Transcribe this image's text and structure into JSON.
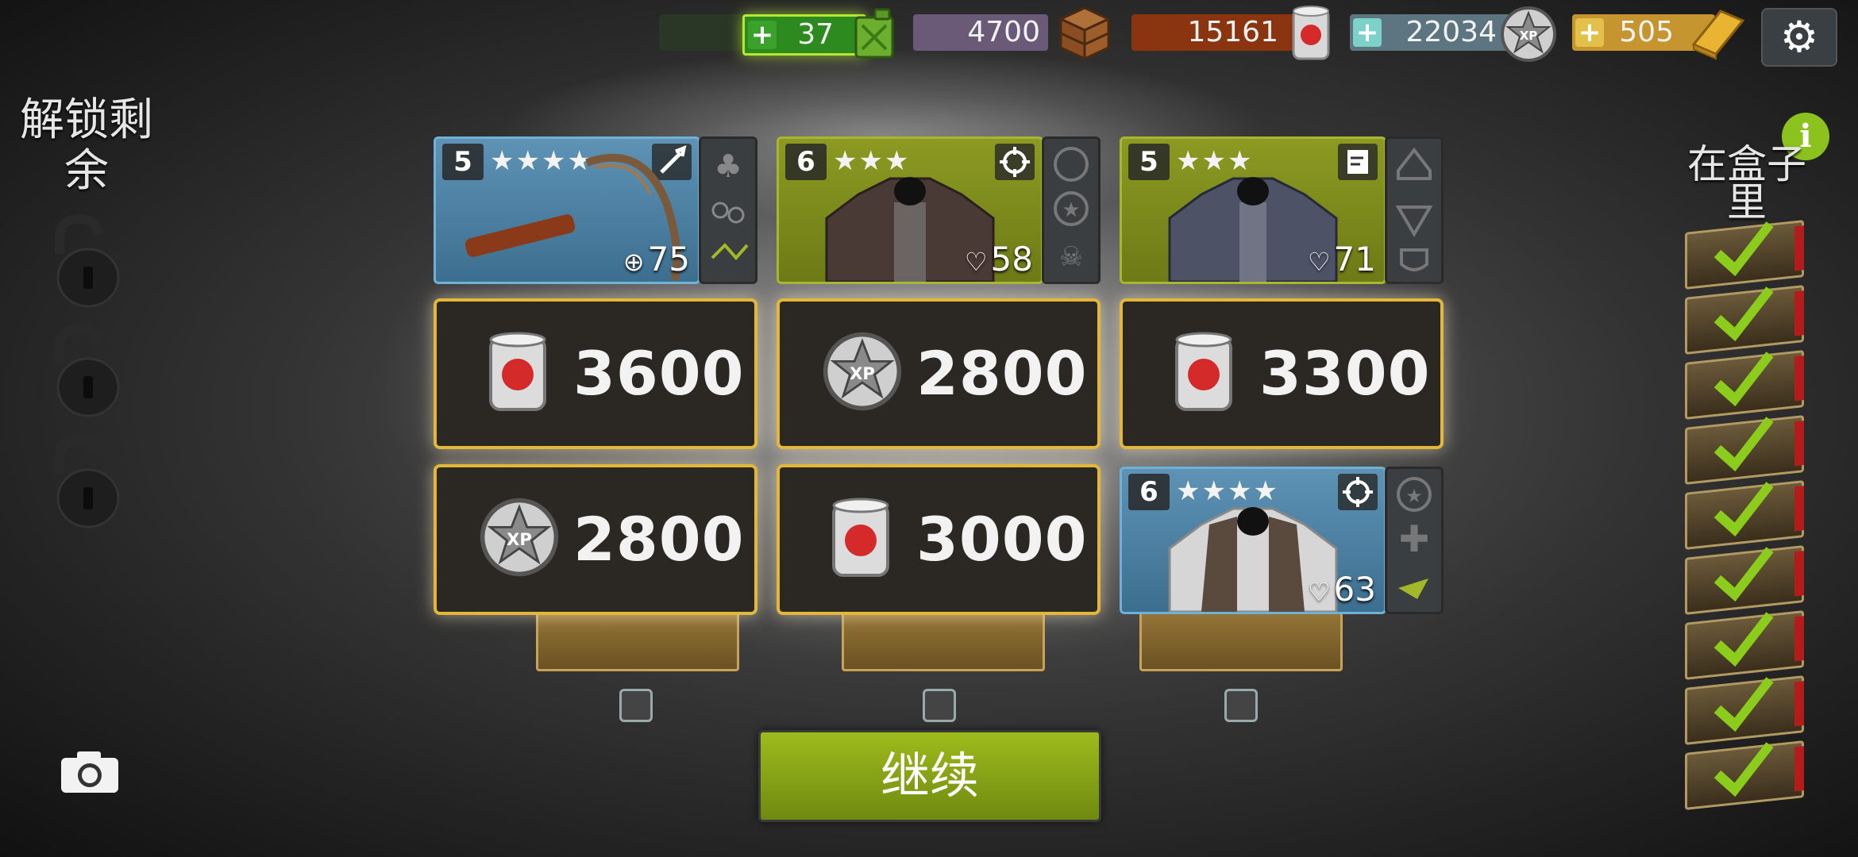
{
  "resources": {
    "fuel": {
      "value": "37",
      "icon": "fuel-can-icon"
    },
    "crate": {
      "value": "4700",
      "icon": "wooden-crate-icon"
    },
    "food": {
      "value": "15161",
      "icon": "tomato-can-icon"
    },
    "xp": {
      "value": "22034",
      "icon": "xp-badge-icon"
    },
    "gold": {
      "value": "505",
      "icon": "gold-bar-icon"
    }
  },
  "settings_icon": "gear-icon",
  "left_panel": {
    "title": "解锁剩余",
    "locks": 3
  },
  "right_panel": {
    "title": "在盒子里",
    "boxes_checked": 9
  },
  "items": [
    {
      "level": "5",
      "stars": "★★★★",
      "type_icon": "melee-icon",
      "stat_icon": "crosshair",
      "stat": "75",
      "color": "blue",
      "name": "sickle"
    },
    {
      "level": "6",
      "stars": "★★★",
      "type_icon": "crosshair-icon",
      "stat_icon": "heart",
      "stat": "58",
      "color": "olive",
      "name": "armored-jacket"
    },
    {
      "level": "5",
      "stars": "★★★",
      "type_icon": "armor-icon",
      "stat_icon": "heart",
      "stat": "71",
      "color": "olive",
      "name": "camo-jacket"
    },
    {
      "level": "6",
      "stars": "★★★★",
      "type_icon": "crosshair-icon",
      "stat_icon": "heart",
      "stat": "63",
      "color": "blue",
      "name": "vest-jacket"
    }
  ],
  "rewards": [
    {
      "type": "food",
      "amount": "3600"
    },
    {
      "type": "xp",
      "amount": "2800"
    },
    {
      "type": "food",
      "amount": "3300"
    },
    {
      "type": "xp",
      "amount": "2800"
    },
    {
      "type": "food",
      "amount": "3000"
    }
  ],
  "continue_label": "继续",
  "colors": {
    "accent_green": "#9ebb1c",
    "tile_border": "#e3b83a",
    "card_blue": "#5e93b5",
    "card_olive": "#8c9a22"
  }
}
